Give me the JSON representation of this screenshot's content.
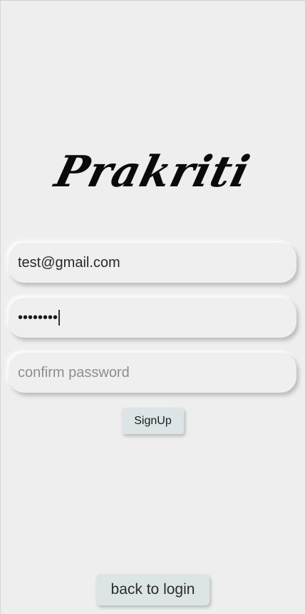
{
  "brand": {
    "title": "Prakriti"
  },
  "form": {
    "email": {
      "value": "test@gmail.com"
    },
    "password": {
      "masked_value": "••••••••"
    },
    "confirm_password": {
      "placeholder": "confirm password",
      "value": ""
    },
    "signup_label": "SignUp"
  },
  "footer": {
    "back_label": "back to login"
  },
  "colors": {
    "background": "#eeeeee",
    "button_bg": "#dde4e6",
    "text": "#1e1e1e",
    "placeholder": "#8e8e8e"
  }
}
